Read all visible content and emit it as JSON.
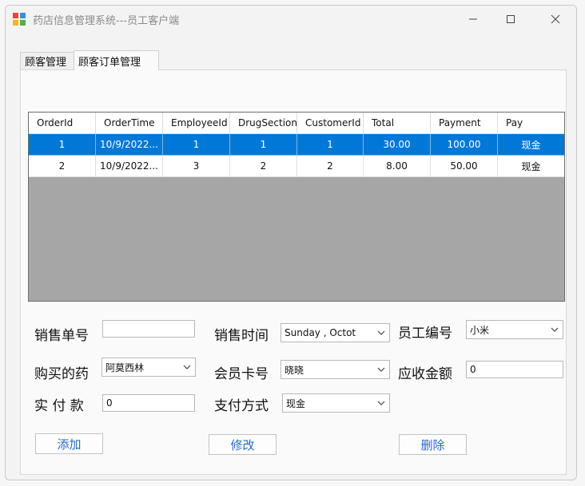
{
  "window": {
    "title": "药店信息管理系统---员工客户端",
    "controls": [
      "minimize-icon",
      "maximize-icon",
      "close-icon"
    ]
  },
  "tabs": [
    {
      "label": "顾客管理",
      "active": false
    },
    {
      "label": "顾客订单管理",
      "active": true
    }
  ],
  "grid": {
    "columns": [
      "OrderId",
      "OrderTime",
      "EmployeeId",
      "DrugSectionI",
      "CustomerId",
      "Total",
      "Payment",
      "Pay"
    ],
    "rows": [
      {
        "selected": true,
        "cells": [
          "1",
          "10/9/2022...",
          "1",
          "1",
          "1",
          "30.00",
          "100.00",
          "现金"
        ]
      },
      {
        "selected": false,
        "cells": [
          "2",
          "10/9/2022...",
          "3",
          "2",
          "2",
          "8.00",
          "50.00",
          "现金"
        ]
      }
    ]
  },
  "form": {
    "sale_no": {
      "label": "销售单号",
      "value": ""
    },
    "sale_time": {
      "label": "销售时间",
      "value": "Sunday  ,  Octot"
    },
    "employee_no": {
      "label": "员工编号",
      "value": "小米"
    },
    "drug": {
      "label": "购买的药",
      "value": "阿莫西林"
    },
    "member_card": {
      "label": "会员卡号",
      "value": "晓晓"
    },
    "receivable": {
      "label": "应收金额",
      "value": "0"
    },
    "paid": {
      "label": "实 付 款",
      "value": "0"
    },
    "pay_method": {
      "label": "支付方式",
      "value": "现金"
    }
  },
  "buttons": {
    "add": "添加",
    "edit": "修改",
    "delete": "删除"
  },
  "colors": {
    "selection": "#0078d7",
    "grid_background": "#a6a6a6",
    "button_text": "#2b6cc4"
  }
}
